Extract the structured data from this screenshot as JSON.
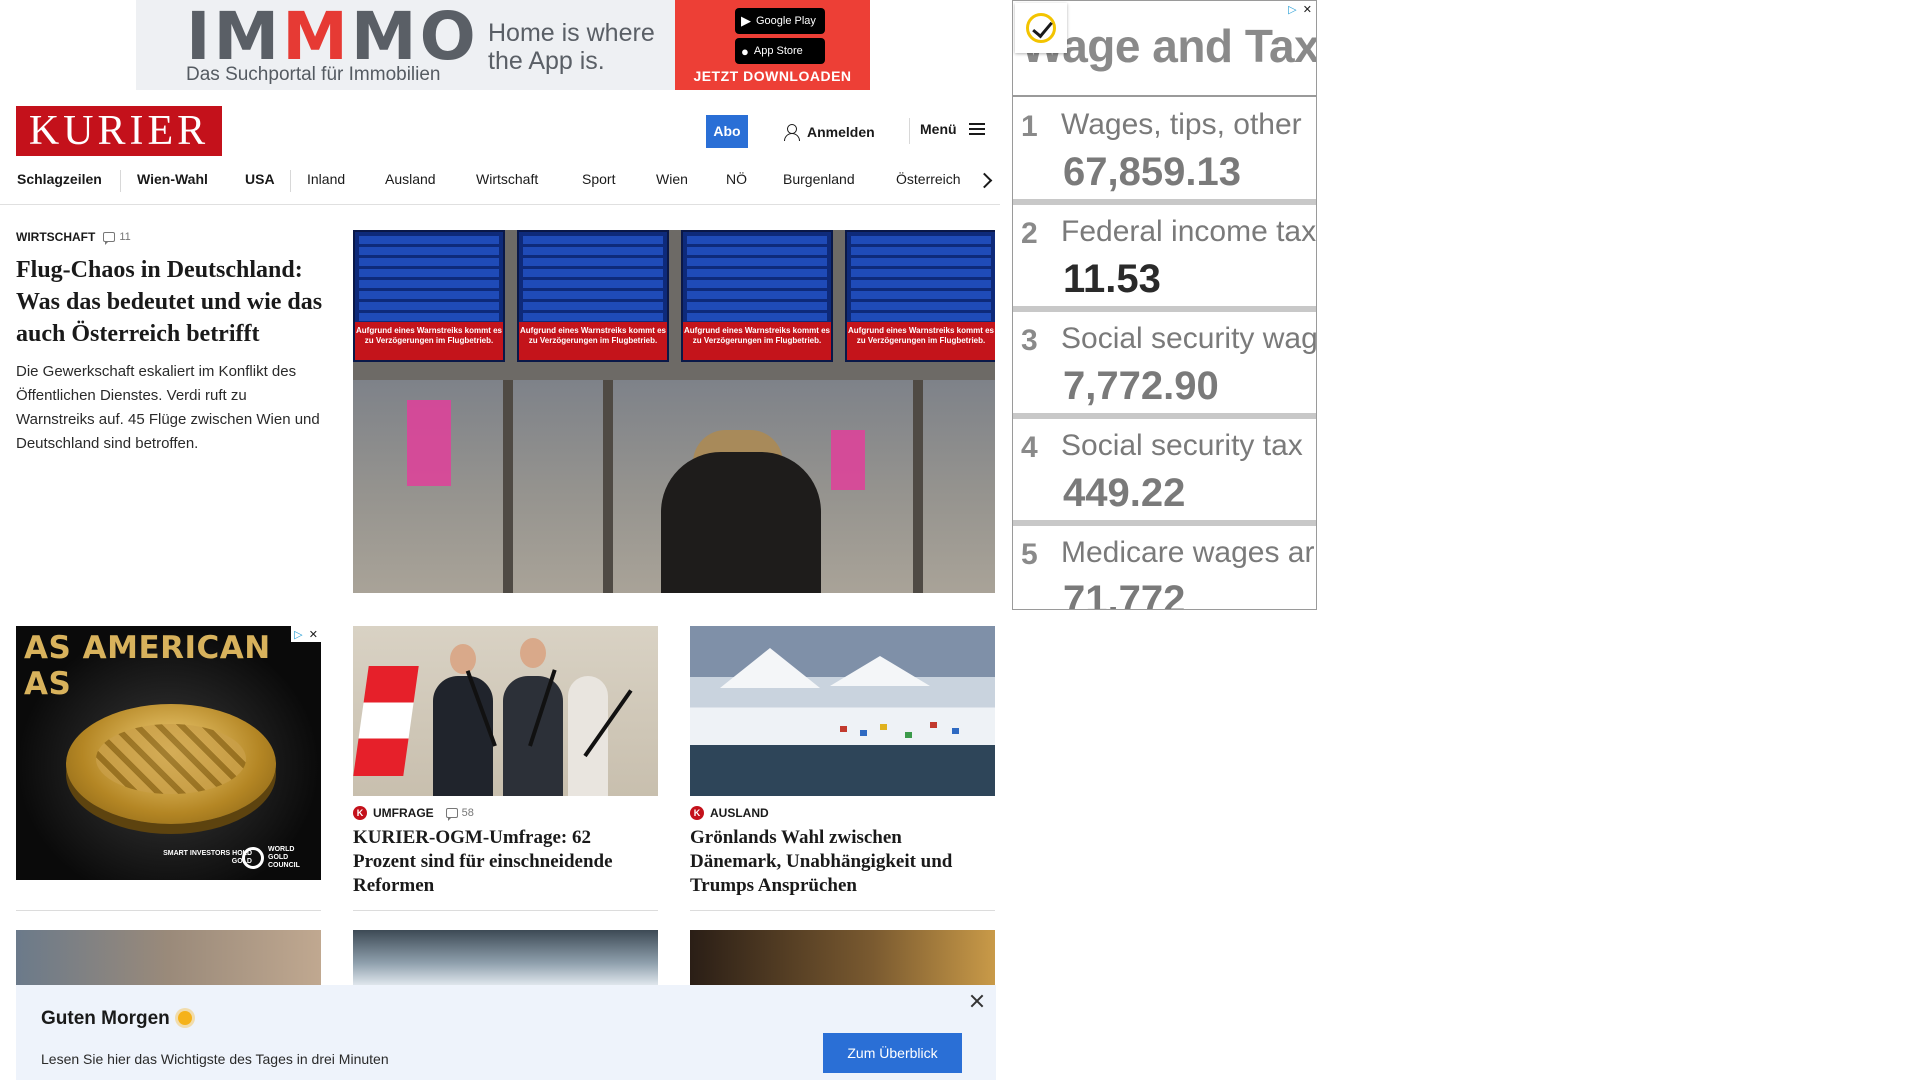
{
  "top_ad": {
    "brand_left": "IM",
    "brand_mid": "M",
    "brand_right": "MO",
    "subline": "Das Suchportal für Immobilien",
    "slogan": "Home is where the App is.",
    "google_badge": "Google Play",
    "apple_badge": "App Store",
    "cta": "JETZT DOWNLOADEN"
  },
  "header": {
    "logo": "KURIER",
    "abo_label": "Abo",
    "login_label": "Anmelden",
    "menu_label": "Menü"
  },
  "nav": {
    "items": [
      "Schlagzeilen",
      "Wien-Wahl",
      "USA",
      "Inland",
      "Ausland",
      "Wirtschaft",
      "Sport",
      "Wien",
      "NÖ",
      "Burgenland",
      "Österreich"
    ]
  },
  "lead": {
    "kicker": "WIRTSCHAFT",
    "comments": "11",
    "title": "Flug-Chaos in Deutschland: Was das bedeutet und wie das auch Österreich betrifft",
    "teaser": "Die Gewerkschaft eskaliert im Konflikt des Öffentlichen Dienstes. Verdi ruft zu Warnstreiks auf. 45 Flüge zwischen Wien und Deutschland sind betroffen.",
    "board_warning": "Aufgrund eines Warnstreiks kommt es zu Verzögerungen im Flugbetrieb."
  },
  "pie_ad": {
    "headline": "AS AMERICAN AS",
    "tagline": "SMART INVESTORS HOLD GOLD",
    "sponsor": "WORLD GOLD COUNCIL"
  },
  "cards": [
    {
      "kicker": "UMFRAGE",
      "comments": "58",
      "title": "KURIER-OGM-Umfrage: 62 Prozent sind für einschneidende Reformen"
    },
    {
      "kicker": "AUSLAND",
      "comments": "",
      "title": "Grönlands Wahl zwischen Dänemark, Unabhängigkeit und Trumps Ansprüchen"
    }
  ],
  "morning": {
    "title": "Guten Morgen",
    "text": "Lesen Sie hier das Wichtigste des Tages in drei Minuten",
    "button": "Zum Überblick"
  },
  "tax_ad": {
    "heading": "Wage and Tax",
    "rows": [
      {
        "num": "1",
        "label": "Wages, tips, other",
        "value": "67,859.13"
      },
      {
        "num": "2",
        "label": "Federal income tax",
        "value": "11.53"
      },
      {
        "num": "3",
        "label": "Social security wag",
        "value": "7,772.90"
      },
      {
        "num": "4",
        "label": "Social security tax",
        "value": "449.22"
      },
      {
        "num": "5",
        "label": "Medicare wages ar",
        "value": "71,772"
      }
    ]
  },
  "colors": {
    "brand_red": "#c4111b",
    "accent_blue": "#2a6fd6",
    "morning_bg": "#eef3fb"
  }
}
